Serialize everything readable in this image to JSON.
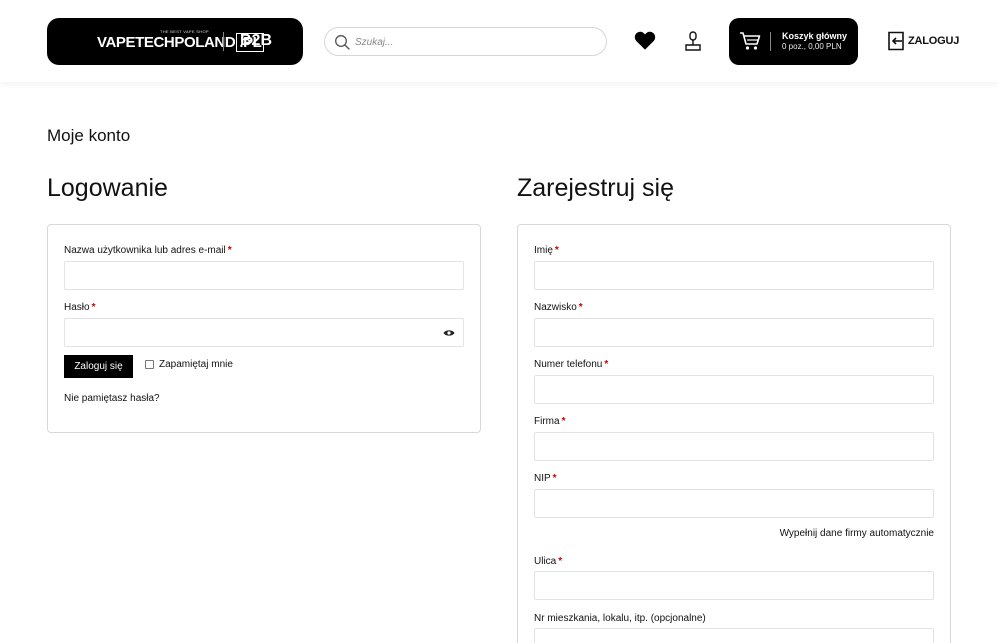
{
  "header": {
    "logo_tagline": "THE BEST VAPE SHOP",
    "logo_brand": "VAPETECHPOLAND",
    "logo_tld": ".PL",
    "logo_badge": "B2B",
    "search_placeholder": "Szukaj...",
    "cart_title": "Koszyk główny",
    "cart_summary": "0 poz.,  0,00 PLN",
    "login_label": "ZALOGUJ",
    "icons": [
      "search-icon",
      "heart-icon",
      "user-icon",
      "cart-icon",
      "login-icon"
    ]
  },
  "page": {
    "breadcrumb": "Moje konto"
  },
  "login": {
    "title": "Logowanie",
    "username_label": "Nazwa użytkownika lub adres e-mail",
    "password_label": "Hasło",
    "required_mark": "*",
    "submit_label": "Zaloguj się",
    "remember_label": "Zapamiętaj mnie",
    "forgot_label": "Nie pamiętasz hasła?"
  },
  "register": {
    "title": "Zarejestruj się",
    "fields": [
      {
        "label": "Imię",
        "req": "*"
      },
      {
        "label": "Nazwisko",
        "req": "*"
      },
      {
        "label": "Numer telefonu",
        "req": "*"
      },
      {
        "label": "Firma",
        "req": "*"
      },
      {
        "label": "NIP",
        "req": "*"
      },
      {
        "label": "Ulica",
        "req": "*"
      },
      {
        "label": "Nr mieszkania, lokalu, itp. (opcjonalne)",
        "req": ""
      }
    ],
    "autofill_label": "Wypełnij dane firmy automatycznie"
  },
  "colors": {
    "brand": "#000000",
    "required": "#cc0000",
    "border": "#d8d8d8"
  }
}
